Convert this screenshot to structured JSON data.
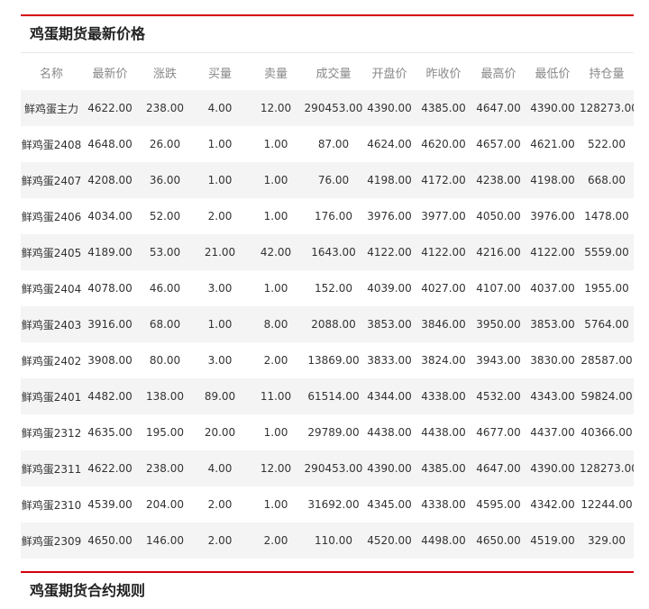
{
  "panel_title": "鸡蛋期货最新价格",
  "columns": [
    "名称",
    "最新价",
    "涨跌",
    "买量",
    "卖量",
    "成交量",
    "开盘价",
    "昨收价",
    "最高价",
    "最低价",
    "持仓量"
  ],
  "rows": [
    {
      "name": "鲜鸡蛋主力",
      "last": "4622.00",
      "change": "238.00",
      "bid": "4.00",
      "ask": "12.00",
      "volume": "290453.00",
      "open": "4390.00",
      "prev": "4385.00",
      "high": "4647.00",
      "low": "4390.00",
      "oi": "128273.00",
      "c": [
        "r",
        "r",
        "r",
        "n",
        "n",
        "n",
        "r",
        "n",
        "r",
        "r",
        "n"
      ]
    },
    {
      "name": "鲜鸡蛋2408",
      "last": "4648.00",
      "change": "26.00",
      "bid": "1.00",
      "ask": "1.00",
      "volume": "87.00",
      "open": "4624.00",
      "prev": "4620.00",
      "high": "4657.00",
      "low": "4621.00",
      "oi": "522.00",
      "c": [
        "n",
        "r",
        "r",
        "n",
        "n",
        "n",
        "r",
        "n",
        "r",
        "r",
        "n"
      ]
    },
    {
      "name": "鲜鸡蛋2407",
      "last": "4208.00",
      "change": "36.00",
      "bid": "1.00",
      "ask": "1.00",
      "volume": "76.00",
      "open": "4198.00",
      "prev": "4172.00",
      "high": "4238.00",
      "low": "4198.00",
      "oi": "668.00",
      "c": [
        "n",
        "r",
        "r",
        "n",
        "n",
        "n",
        "r",
        "n",
        "r",
        "r",
        "n"
      ]
    },
    {
      "name": "鲜鸡蛋2406",
      "last": "4034.00",
      "change": "52.00",
      "bid": "2.00",
      "ask": "1.00",
      "volume": "176.00",
      "open": "3976.00",
      "prev": "3977.00",
      "high": "4050.00",
      "low": "3976.00",
      "oi": "1478.00",
      "c": [
        "n",
        "r",
        "r",
        "n",
        "n",
        "n",
        "g",
        "n",
        "r",
        "g",
        "n"
      ]
    },
    {
      "name": "鲜鸡蛋2405",
      "last": "4189.00",
      "change": "53.00",
      "bid": "21.00",
      "ask": "42.00",
      "volume": "1643.00",
      "open": "4122.00",
      "prev": "4122.00",
      "high": "4216.00",
      "low": "4122.00",
      "oi": "5559.00",
      "c": [
        "n",
        "r",
        "r",
        "n",
        "n",
        "n",
        "n",
        "n",
        "r",
        "n",
        "n"
      ]
    },
    {
      "name": "鲜鸡蛋2404",
      "last": "4078.00",
      "change": "46.00",
      "bid": "3.00",
      "ask": "1.00",
      "volume": "152.00",
      "open": "4039.00",
      "prev": "4027.00",
      "high": "4107.00",
      "low": "4037.00",
      "oi": "1955.00",
      "c": [
        "n",
        "r",
        "r",
        "n",
        "n",
        "n",
        "r",
        "n",
        "r",
        "r",
        "n"
      ]
    },
    {
      "name": "鲜鸡蛋2403",
      "last": "3916.00",
      "change": "68.00",
      "bid": "1.00",
      "ask": "8.00",
      "volume": "2088.00",
      "open": "3853.00",
      "prev": "3846.00",
      "high": "3950.00",
      "low": "3853.00",
      "oi": "5764.00",
      "c": [
        "n",
        "r",
        "r",
        "n",
        "n",
        "n",
        "r",
        "n",
        "r",
        "r",
        "n"
      ]
    },
    {
      "name": "鲜鸡蛋2402",
      "last": "3908.00",
      "change": "80.00",
      "bid": "3.00",
      "ask": "2.00",
      "volume": "13869.00",
      "open": "3833.00",
      "prev": "3824.00",
      "high": "3943.00",
      "low": "3830.00",
      "oi": "28587.00",
      "c": [
        "n",
        "r",
        "r",
        "n",
        "n",
        "n",
        "r",
        "n",
        "r",
        "r",
        "n"
      ]
    },
    {
      "name": "鲜鸡蛋2401",
      "last": "4482.00",
      "change": "138.00",
      "bid": "89.00",
      "ask": "11.00",
      "volume": "61514.00",
      "open": "4344.00",
      "prev": "4338.00",
      "high": "4532.00",
      "low": "4343.00",
      "oi": "59824.00",
      "c": [
        "n",
        "r",
        "r",
        "n",
        "n",
        "n",
        "r",
        "n",
        "r",
        "r",
        "n"
      ]
    },
    {
      "name": "鲜鸡蛋2312",
      "last": "4635.00",
      "change": "195.00",
      "bid": "20.00",
      "ask": "1.00",
      "volume": "29789.00",
      "open": "4438.00",
      "prev": "4438.00",
      "high": "4677.00",
      "low": "4437.00",
      "oi": "40366.00",
      "c": [
        "n",
        "r",
        "r",
        "n",
        "n",
        "n",
        "n",
        "n",
        "r",
        "g",
        "n"
      ]
    },
    {
      "name": "鲜鸡蛋2311",
      "last": "4622.00",
      "change": "238.00",
      "bid": "4.00",
      "ask": "12.00",
      "volume": "290453.00",
      "open": "4390.00",
      "prev": "4385.00",
      "high": "4647.00",
      "low": "4390.00",
      "oi": "128273.00",
      "c": [
        "n",
        "r",
        "r",
        "n",
        "n",
        "n",
        "r",
        "n",
        "r",
        "r",
        "n"
      ]
    },
    {
      "name": "鲜鸡蛋2310",
      "last": "4539.00",
      "change": "204.00",
      "bid": "2.00",
      "ask": "1.00",
      "volume": "31692.00",
      "open": "4345.00",
      "prev": "4338.00",
      "high": "4595.00",
      "low": "4342.00",
      "oi": "12244.00",
      "c": [
        "n",
        "r",
        "r",
        "n",
        "n",
        "n",
        "r",
        "n",
        "r",
        "r",
        "n"
      ]
    },
    {
      "name": "鲜鸡蛋2309",
      "last": "4650.00",
      "change": "146.00",
      "bid": "2.00",
      "ask": "2.00",
      "volume": "110.00",
      "open": "4520.00",
      "prev": "4498.00",
      "high": "4650.00",
      "low": "4519.00",
      "oi": "329.00",
      "c": [
        "n",
        "r",
        "r",
        "n",
        "n",
        "n",
        "r",
        "n",
        "r",
        "r",
        "n"
      ]
    }
  ],
  "colors": {
    "up": "#e4101e",
    "down": "#109e10",
    "accent": "#d6000f"
  },
  "panel2_title": "鸡蛋期货合约规则"
}
